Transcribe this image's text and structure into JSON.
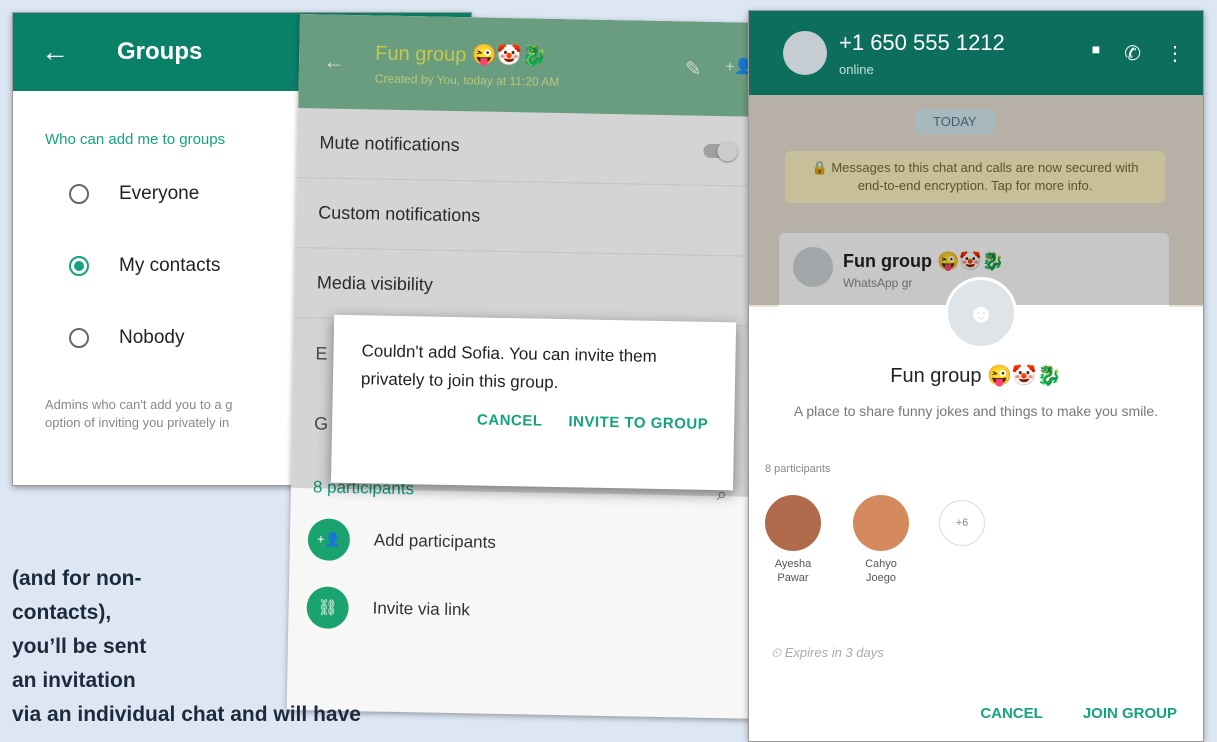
{
  "groups_screen": {
    "back": "←",
    "title": "Groups",
    "section": "Who can add me to groups",
    "options": [
      {
        "label": "Everyone",
        "selected": false
      },
      {
        "label": "My contacts",
        "selected": true
      },
      {
        "label": "Nobody",
        "selected": false
      }
    ],
    "footnote_line1": "Admins who can't add you to a g",
    "footnote_line2": "option of inviting you privately in"
  },
  "group_info": {
    "back": "←",
    "title": "Fun group 😜🤡🐉",
    "subtitle": "Created by You, today at 11:20 AM",
    "edit_icon": "✎",
    "add_icon": "+👤",
    "settings": [
      "Mute notifications",
      "Custom notifications",
      "Media visibility"
    ],
    "stub_1": "E",
    "stub_2": "G",
    "participants_label": "8 participants",
    "search_icon": "⌕",
    "actions": [
      {
        "icon": "+👤",
        "label": "Add participants"
      },
      {
        "icon": "⛓",
        "label": "Invite via link"
      }
    ],
    "dialog": {
      "message": "Couldn't add Sofia. You can invite them privately to join this group.",
      "cancel": "CANCEL",
      "invite": "INVITE TO GROUP"
    }
  },
  "chat": {
    "contact": "+1 650 555 1212",
    "status": "online",
    "video_icon": "■",
    "call_icon": "✆",
    "menu_icon": "⋮",
    "date_chip": "TODAY",
    "encryption_notice": "🔒 Messages to this chat and calls are now secured with end-to-end encryption. Tap for more info.",
    "invite_title": "Fun group 😜🤡🐉",
    "invite_sub": "WhatsApp gr",
    "sheet": {
      "group_name": "Fun group 😜🤡🐉",
      "description": "A place to share funny jokes and things to make you smile.",
      "participant_count": "8 participants",
      "members": [
        {
          "line1": "Ayesha",
          "line2": "Pawar",
          "color": "#b06a4c"
        },
        {
          "line1": "Cahyo",
          "line2": "Joego",
          "color": "#d48a5c"
        }
      ],
      "more": "+6",
      "expires": "⏲ Expires in 3 days",
      "cancel": "CANCEL",
      "join": "JOIN GROUP"
    }
  },
  "caption": {
    "line1": "(and for non-",
    "line2": "contacts),",
    "line3": "you’ll be sent",
    "line4": "an invitation",
    "line5": "via an individual chat and will have"
  },
  "colors": {
    "whatsapp_green": "#0a8068",
    "accent": "#13a37f",
    "page_background": "#dde7f4"
  }
}
